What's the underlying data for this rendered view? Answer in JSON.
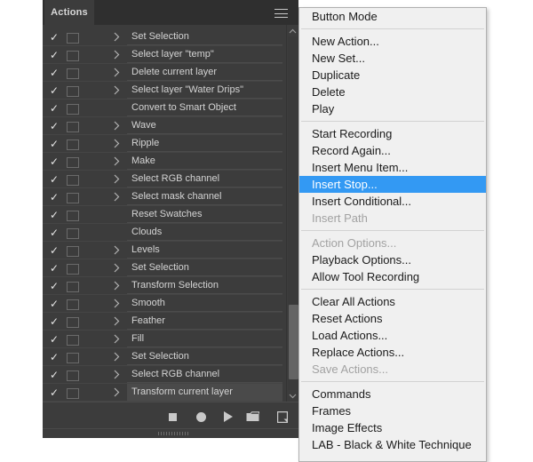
{
  "panel": {
    "tab_label": "Actions",
    "menu_icon": "hamburger-icon",
    "rows": [
      {
        "checked": "✓",
        "has_dialog_box": true,
        "expandable": true,
        "label": "Set Selection"
      },
      {
        "checked": "✓",
        "has_dialog_box": true,
        "expandable": true,
        "label": "Select layer \"temp\""
      },
      {
        "checked": "✓",
        "has_dialog_box": true,
        "expandable": true,
        "label": "Delete current layer"
      },
      {
        "checked": "✓",
        "has_dialog_box": true,
        "expandable": true,
        "label": "Select layer \"Water Drips\""
      },
      {
        "checked": "✓",
        "has_dialog_box": true,
        "expandable": false,
        "label": "Convert to Smart Object"
      },
      {
        "checked": "✓",
        "has_dialog_box": true,
        "expandable": true,
        "label": "Wave"
      },
      {
        "checked": "✓",
        "has_dialog_box": true,
        "expandable": true,
        "label": "Ripple"
      },
      {
        "checked": "✓",
        "has_dialog_box": true,
        "expandable": true,
        "label": "Make"
      },
      {
        "checked": "✓",
        "has_dialog_box": true,
        "expandable": true,
        "label": "Select RGB channel"
      },
      {
        "checked": "✓",
        "has_dialog_box": true,
        "expandable": true,
        "label": "Select mask channel"
      },
      {
        "checked": "✓",
        "has_dialog_box": true,
        "expandable": false,
        "label": "Reset Swatches"
      },
      {
        "checked": "✓",
        "has_dialog_box": true,
        "expandable": false,
        "label": "Clouds"
      },
      {
        "checked": "✓",
        "has_dialog_box": true,
        "expandable": true,
        "label": "Levels"
      },
      {
        "checked": "✓",
        "has_dialog_box": true,
        "expandable": true,
        "label": "Set Selection"
      },
      {
        "checked": "✓",
        "has_dialog_box": true,
        "expandable": true,
        "label": "Transform Selection"
      },
      {
        "checked": "✓",
        "has_dialog_box": true,
        "expandable": true,
        "label": "Smooth"
      },
      {
        "checked": "✓",
        "has_dialog_box": true,
        "expandable": true,
        "label": "Feather"
      },
      {
        "checked": "✓",
        "has_dialog_box": true,
        "expandable": true,
        "label": "Fill"
      },
      {
        "checked": "✓",
        "has_dialog_box": true,
        "expandable": true,
        "label": "Set Selection"
      },
      {
        "checked": "✓",
        "has_dialog_box": true,
        "expandable": true,
        "label": "Select RGB channel"
      },
      {
        "checked": "✓",
        "has_dialog_box": true,
        "expandable": true,
        "label": "Transform current layer",
        "selected": true
      }
    ],
    "scrollbar": {
      "up_arrow": "chevron-up-icon",
      "down_arrow": "chevron-down-icon",
      "thumb_top_pct": 76,
      "thumb_height_pct": 21
    },
    "toolbar": [
      {
        "name": "stop-button",
        "icon": "stop-square-icon"
      },
      {
        "name": "record-button",
        "icon": "record-circle-icon"
      },
      {
        "name": "play-button",
        "icon": "play-triangle-icon"
      },
      {
        "name": "new-set-button",
        "icon": "folder-icon"
      },
      {
        "name": "new-action-button",
        "icon": "new-document-icon"
      },
      {
        "name": "delete-button",
        "icon": "trash-icon"
      }
    ]
  },
  "flyout_menu": {
    "items": [
      {
        "label": "Button Mode",
        "state": "normal"
      },
      {
        "type": "separator"
      },
      {
        "label": "New Action...",
        "state": "normal"
      },
      {
        "label": "New Set...",
        "state": "normal"
      },
      {
        "label": "Duplicate",
        "state": "normal"
      },
      {
        "label": "Delete",
        "state": "normal"
      },
      {
        "label": "Play",
        "state": "normal"
      },
      {
        "type": "separator"
      },
      {
        "label": "Start Recording",
        "state": "normal"
      },
      {
        "label": "Record Again...",
        "state": "normal"
      },
      {
        "label": "Insert Menu Item...",
        "state": "normal"
      },
      {
        "label": "Insert Stop...",
        "state": "highlighted"
      },
      {
        "label": "Insert Conditional...",
        "state": "normal"
      },
      {
        "label": "Insert Path",
        "state": "disabled"
      },
      {
        "type": "separator"
      },
      {
        "label": "Action Options...",
        "state": "disabled"
      },
      {
        "label": "Playback Options...",
        "state": "normal"
      },
      {
        "label": "Allow Tool Recording",
        "state": "normal"
      },
      {
        "type": "separator"
      },
      {
        "label": "Clear All Actions",
        "state": "normal"
      },
      {
        "label": "Reset Actions",
        "state": "normal"
      },
      {
        "label": "Load Actions...",
        "state": "normal"
      },
      {
        "label": "Replace Actions...",
        "state": "normal"
      },
      {
        "label": "Save Actions...",
        "state": "disabled"
      },
      {
        "type": "separator"
      },
      {
        "label": "Commands",
        "state": "normal"
      },
      {
        "label": "Frames",
        "state": "normal"
      },
      {
        "label": "Image Effects",
        "state": "normal"
      },
      {
        "label": "LAB - Black & White Technique",
        "state": "normal"
      }
    ]
  },
  "colors": {
    "panel_bg": "#3c3c3c",
    "tabstrip_bg": "#2f2f2f",
    "row_text": "#d4d4d4",
    "selected_row": "#4a4a4a",
    "menu_bg": "#f0f0f0",
    "menu_highlight": "#3399f3",
    "menu_text": "#1b1b1b",
    "menu_disabled_text": "#a2a2a2"
  }
}
